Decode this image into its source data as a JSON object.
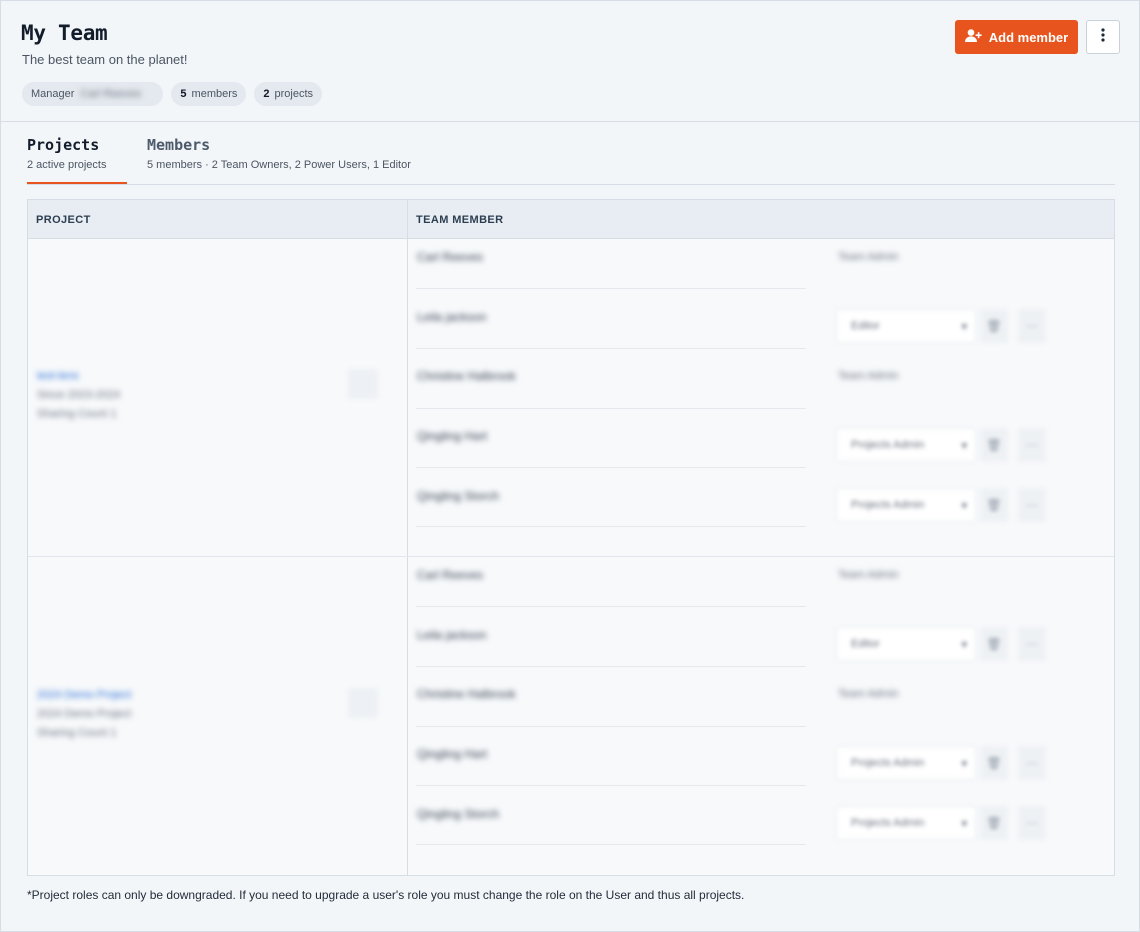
{
  "header": {
    "title": "My Team",
    "subtitle": "The best team on the planet!",
    "chips": {
      "manager_label": "Manager",
      "manager_name": "Carl Reeves",
      "members_count": "5",
      "members_label": "members",
      "projects_count": "2",
      "projects_label": "projects"
    },
    "add_member_label": "Add member"
  },
  "tabs": [
    {
      "title": "Projects",
      "subtitle": "2 active projects"
    },
    {
      "title": "Members",
      "subtitle": "5 members · 2 Team Owners, 2 Power Users, 1 Editor"
    }
  ],
  "table": {
    "col_project": "PROJECT",
    "col_member": "TEAM MEMBER",
    "projects": [
      {
        "name": "test-lens",
        "meta1": "Since 2023-2024",
        "meta2": "Sharing Count 1",
        "members": [
          {
            "name": "Carl Reeves",
            "role": "Team Admin",
            "editable": false
          },
          {
            "name": "Leila jackson",
            "role": "Editor",
            "editable": true
          },
          {
            "name": "Christine Halbrook",
            "role": "Team Admin",
            "editable": false
          },
          {
            "name": "Qingling Hart",
            "role": "Projects Admin",
            "editable": true
          },
          {
            "name": "Qingling Storch",
            "role": "Projects Admin",
            "editable": true
          }
        ]
      },
      {
        "name": "2024 Demo Project",
        "meta1": "2024 Demo Project",
        "meta2": "Sharing Count 1",
        "members": [
          {
            "name": "Carl Reeves",
            "role": "Team Admin",
            "editable": false
          },
          {
            "name": "Leila jackson",
            "role": "Editor",
            "editable": true
          },
          {
            "name": "Christine Halbrook",
            "role": "Team Admin",
            "editable": false
          },
          {
            "name": "Qingling Hart",
            "role": "Projects Admin",
            "editable": true
          },
          {
            "name": "Qingling Storch",
            "role": "Projects Admin",
            "editable": true
          }
        ]
      }
    ]
  },
  "footnote": "*Project roles can only be downgraded. If you need to upgrade a user's role you must change the role on the User and thus all projects.",
  "colors": {
    "accent": "#e8541e",
    "link": "#2a6fd6"
  }
}
